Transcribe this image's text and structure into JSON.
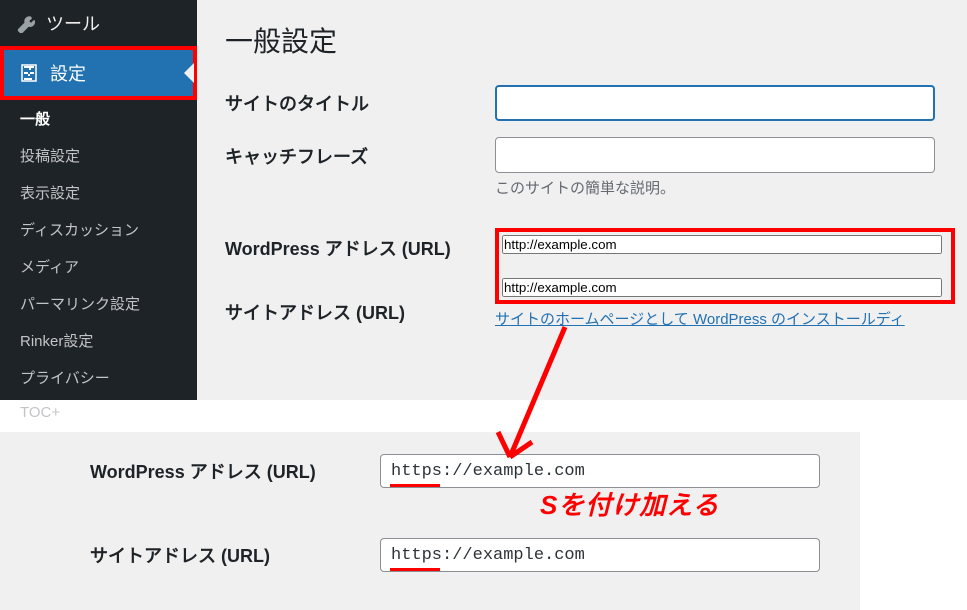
{
  "sidebar": {
    "top_items": [
      {
        "label": "ツール"
      },
      {
        "label": "設定"
      }
    ],
    "submenu": [
      {
        "label": "一般",
        "active": true
      },
      {
        "label": "投稿設定"
      },
      {
        "label": "表示設定"
      },
      {
        "label": "ディスカッション"
      },
      {
        "label": "メディア"
      },
      {
        "label": "パーマリンク設定"
      },
      {
        "label": "Rinker設定"
      },
      {
        "label": "プライバシー"
      },
      {
        "label": "TOC+"
      }
    ]
  },
  "page": {
    "title": "一般設定"
  },
  "form": {
    "site_title": {
      "label": "サイトのタイトル",
      "value": ""
    },
    "tagline": {
      "label": "キャッチフレーズ",
      "value": "",
      "desc": "このサイトの簡単な説明。"
    },
    "wp_url": {
      "label": "WordPress アドレス (URL)",
      "value": "http://example.com"
    },
    "site_url": {
      "label": "サイトアドレス (URL)",
      "value": "http://example.com",
      "link": "サイトのホームページとして WordPress のインストールディ"
    }
  },
  "lower": {
    "wp_url": {
      "label": "WordPress アドレス (URL)",
      "value": "https://example.com"
    },
    "site_url": {
      "label": "サイトアドレス (URL)",
      "value": "https://example.com"
    }
  },
  "annotation": {
    "text": "Sを付け加える"
  }
}
